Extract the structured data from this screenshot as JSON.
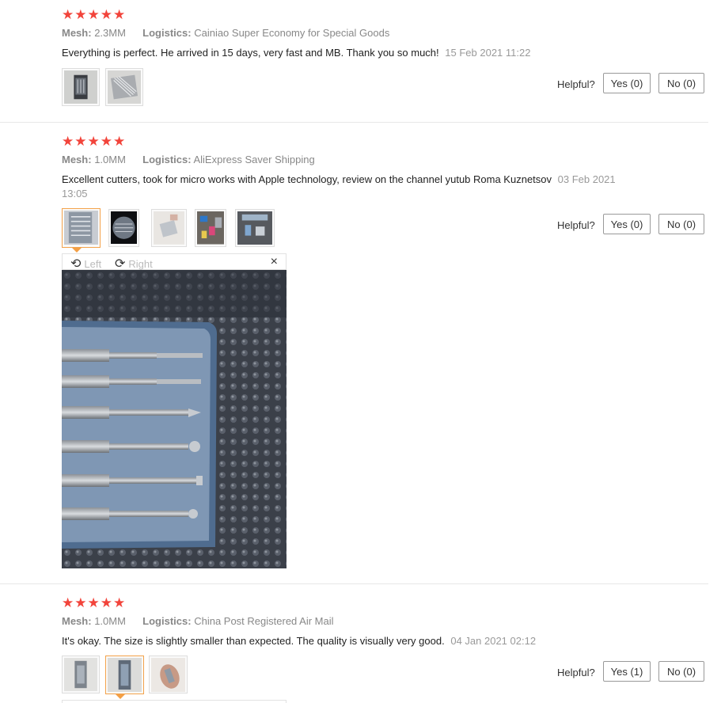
{
  "reviews": [
    {
      "stars": 5,
      "mesh_label": "Mesh:",
      "mesh_value": "2.3MM",
      "logistics_label": "Logistics:",
      "logistics_value": "Cainiao Super Economy for Special Goods",
      "text": "Everything is perfect. He arrived in 15 days, very fast and MB. Thank you so much!",
      "date": "15 Feb 2021 11:22",
      "helpful_label": "Helpful?",
      "yes_label": "Yes (0)",
      "no_label": "No (0)"
    },
    {
      "stars": 5,
      "mesh_label": "Mesh:",
      "mesh_value": "1.0MM",
      "logistics_label": "Logistics:",
      "logistics_value": "AliExpress Saver Shipping",
      "text": "Excellent cutters, took for micro works with Apple technology, review on the channel yutub Roma Kuznetsov",
      "date": "03 Feb 2021 13:05",
      "helpful_label": "Helpful?",
      "yes_label": "Yes (0)",
      "no_label": "No (0)",
      "viewer": {
        "left_label": "Left",
        "right_label": "Right",
        "close": "×"
      }
    },
    {
      "stars": 5,
      "mesh_label": "Mesh:",
      "mesh_value": "1.0MM",
      "logistics_label": "Logistics:",
      "logistics_value": "China Post Registered Air Mail",
      "text": "It's okay. The size is slightly smaller than expected. The quality is visually very good.",
      "date": "04 Jan 2021 02:12",
      "helpful_label": "Helpful?",
      "yes_label": "Yes (1)",
      "no_label": "No (0)"
    }
  ],
  "icons": {
    "star": "star-icon",
    "rotate_left": "rotate-left-icon",
    "rotate_right": "rotate-right-icon",
    "close": "close-icon"
  },
  "colors": {
    "star": "#f2443b",
    "active_thumb": "#f3a24a",
    "meta_text": "#888888",
    "date_text": "#999999"
  }
}
